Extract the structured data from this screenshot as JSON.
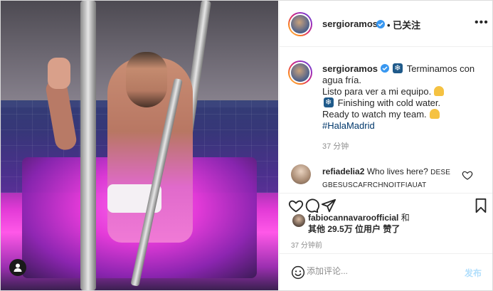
{
  "post": {
    "username": "sergioramos",
    "follow_label": "• 已关注",
    "more_label": "•••"
  },
  "caption": {
    "username": "sergioramos",
    "line1": "Terminamos con agua fría.",
    "line2": "Listo para ver a mi equipo.",
    "line3": "Finishing with cold water.",
    "line4": "Ready to watch my team.",
    "hashtag": "#HalaMadrid",
    "time": "37 分钟"
  },
  "comment": {
    "username": "refiadelia2",
    "text": "Who lives here?",
    "extra": "DESE GBESUSCAFRCHNOITFIAUAT"
  },
  "likes": {
    "user": "fabiocannavaroofficial",
    "and": "和",
    "others": "其他 29.5万 位用户 赞了"
  },
  "timestamp": "37 分钟前",
  "add_comment": {
    "placeholder": "添加评论...",
    "post_label": "发布"
  },
  "icons": {
    "heart": "heart-icon",
    "comment": "comment-icon",
    "share": "share-icon",
    "save": "bookmark-icon",
    "emoji": "emoji-icon",
    "verified": "verified-badge-icon",
    "user_tag": "user-tag-icon"
  },
  "colors": {
    "verified": "#3897f0",
    "hashtag": "#00376b",
    "post_disabled": "#b2dffc"
  }
}
